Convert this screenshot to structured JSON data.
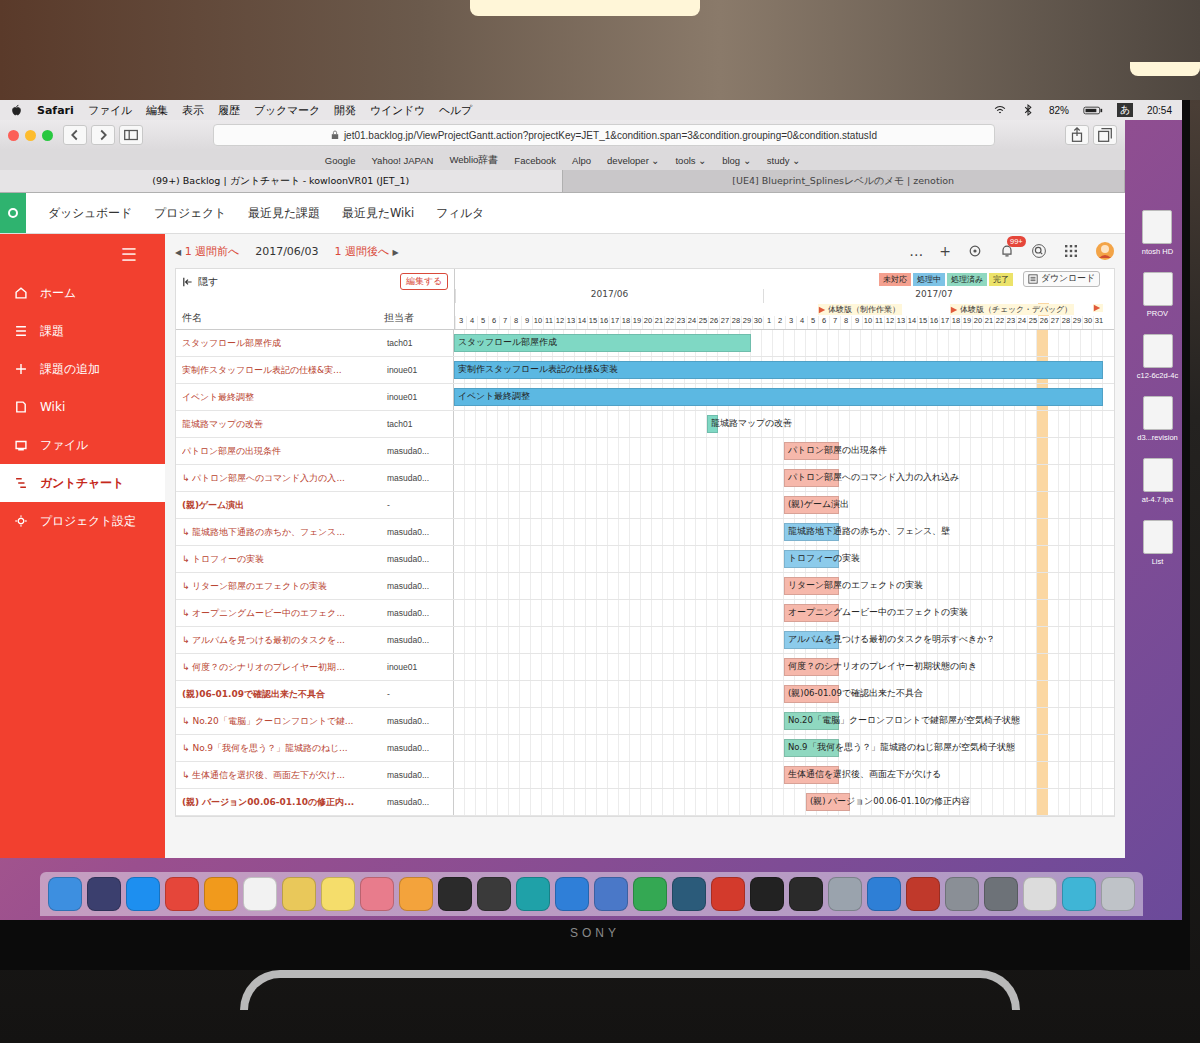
{
  "menubar": {
    "app": "Safari",
    "items": [
      "ファイル",
      "編集",
      "表示",
      "履歴",
      "ブックマーク",
      "開発",
      "ウインドウ",
      "ヘルプ"
    ],
    "status": {
      "battery": "82%",
      "input": "あ",
      "time": "20:54"
    }
  },
  "browser": {
    "url": "jet01.backlog.jp/ViewProjectGantt.action?projectKey=JET_1&condition.span=3&condition.grouping=0&condition.statusId",
    "bookmarks": [
      "Google",
      "Yahoo! JAPAN",
      "Weblio辞書",
      "Facebook",
      "Alpo",
      "developer ⌄",
      "tools ⌄",
      "blog ⌄",
      "study ⌄"
    ],
    "tabs": [
      {
        "label": "(99+) Backlog | ガントチャート - kowloonVR01 (JET_1)",
        "selected": true
      },
      {
        "label": "[UE4] Blueprint_Splinesレベルのメモ | zenotion",
        "selected": false
      }
    ]
  },
  "header": {
    "nav": [
      "ダッシュボード",
      "プロジェクト",
      "最近見た課題",
      "最近見たWiki",
      "フィルタ"
    ],
    "actions": [
      "…",
      "+"
    ],
    "badge": "99+"
  },
  "sidebar": {
    "menu": "☰",
    "items": [
      {
        "label": "ホーム",
        "selected": false
      },
      {
        "label": "課題",
        "selected": false
      },
      {
        "label": "課題の追加",
        "selected": false
      },
      {
        "label": "Wiki",
        "selected": false
      },
      {
        "label": "ファイル",
        "selected": false
      },
      {
        "label": "ガントチャート",
        "selected": true
      },
      {
        "label": "プロジェクト設定",
        "selected": false
      }
    ]
  },
  "toolbar": {
    "prev_arrow": "◀",
    "prev": "1 週間前へ",
    "date": "2017/06/03",
    "next": "1 週間後へ",
    "next_arrow": "▶",
    "hide": "隠す",
    "edit": "編集する",
    "download": "ダウンロード",
    "legend": [
      {
        "label": "未対応",
        "color": "#f4a08f"
      },
      {
        "label": "処理中",
        "color": "#7ec3e6"
      },
      {
        "label": "処理済み",
        "color": "#8fd8c0"
      },
      {
        "label": "完了",
        "color": "#ece36a"
      }
    ]
  },
  "gantt": {
    "columns": [
      "件名",
      "担当者"
    ],
    "months": [
      {
        "label": "2017/06",
        "days": [
          "3",
          "4",
          "5",
          "6",
          "7",
          "8",
          "9",
          "10",
          "11",
          "12",
          "13",
          "14",
          "15",
          "16",
          "17",
          "18",
          "19",
          "20",
          "21",
          "22",
          "23",
          "24",
          "25",
          "26",
          "27",
          "28",
          "29",
          "30"
        ]
      },
      {
        "label": "2017/07",
        "days": [
          "1",
          "2",
          "3",
          "4",
          "5",
          "6",
          "7",
          "8",
          "9",
          "10",
          "11",
          "12",
          "13",
          "14",
          "15",
          "16",
          "17",
          "18",
          "19",
          "20",
          "21",
          "22",
          "23",
          "24",
          "25",
          "26",
          "27",
          "28",
          "29",
          "30",
          "31"
        ]
      }
    ],
    "milestones": [
      {
        "label": "体験版（制作作業）",
        "day": 33
      },
      {
        "label": "体験版（チェック・デバッグ）",
        "day": 45
      },
      {
        "label": "",
        "day": 58
      }
    ],
    "today": 53,
    "tasks": [
      {
        "name": "スタッフロール部屋作成",
        "assignee": "tach01",
        "parent": false,
        "bar": {
          "label": "スタッフロール部屋作成",
          "start": 0,
          "days": 27,
          "color": "#7fd8c4"
        }
      },
      {
        "name": "実制作スタッフロール表記の仕様&実...",
        "assignee": "inoue01",
        "parent": false,
        "bar": {
          "label": "実制作スタッフロール表記の仕様&実装",
          "start": 0,
          "days": 59,
          "color": "#5cb8e2"
        }
      },
      {
        "name": "イベント最終調整",
        "assignee": "inoue01",
        "parent": false,
        "bar": {
          "label": "イベント最終調整",
          "start": 0,
          "days": 59,
          "color": "#5cb8e2"
        }
      },
      {
        "name": "龍城路マップの改善",
        "assignee": "tach01",
        "parent": false,
        "bar": {
          "label": "龍城路マップの改善",
          "start": 23,
          "days": 1,
          "color": "#7fd8c4"
        }
      },
      {
        "name": "パトロン部屋の出現条件",
        "assignee": "masuda0...",
        "parent": false,
        "bar": {
          "label": "パトロン部屋の出現条件",
          "start": 30,
          "days": 5,
          "color": "#f6b8ab"
        }
      },
      {
        "name": "↳ パトロン部屋へのコマンド入力の入...",
        "assignee": "masuda0...",
        "parent": false,
        "bar": {
          "label": "パトロン部屋へのコマンド入力の入れ込み",
          "start": 30,
          "days": 5,
          "color": "#f6b8ab"
        }
      },
      {
        "name": "(親)ゲーム演出",
        "assignee": "-",
        "parent": true,
        "bar": {
          "label": "(親)ゲーム演出",
          "start": 30,
          "days": 5,
          "color": "#f6b8ab"
        }
      },
      {
        "name": "↳ 龍城路地下通路の赤ちか、フェンス...",
        "assignee": "masuda0...",
        "parent": false,
        "bar": {
          "label": "龍城路地下通路の赤ちか、フェンス、壁",
          "start": 30,
          "days": 5,
          "color": "#8ccbeb"
        }
      },
      {
        "name": "↳ トロフィーの実装",
        "assignee": "masuda0...",
        "parent": false,
        "bar": {
          "label": "トロフィーの実装",
          "start": 30,
          "days": 5,
          "color": "#8ccbeb"
        }
      },
      {
        "name": "↳ リターン部屋のエフェクトの実装",
        "assignee": "masuda0...",
        "parent": false,
        "bar": {
          "label": "リターン部屋のエフェクトの実装",
          "start": 30,
          "days": 5,
          "color": "#f6b8ab"
        }
      },
      {
        "name": "↳ オープニングムービー中のエフェク...",
        "assignee": "masuda0...",
        "parent": false,
        "bar": {
          "label": "オープニングムービー中のエフェクトの実装",
          "start": 30,
          "days": 5,
          "color": "#f6b8ab"
        }
      },
      {
        "name": "↳ アルバムを見つける最初のタスクを...",
        "assignee": "masuda0...",
        "parent": false,
        "bar": {
          "label": "アルバムを見つける最初のタスクを明示すべきか？",
          "start": 30,
          "days": 5,
          "color": "#8ccbeb"
        }
      },
      {
        "name": "↳ 何度？のシナリオのプレイヤー初期...",
        "assignee": "inoue01",
        "parent": false,
        "bar": {
          "label": "何度？のシナリオのプレイヤー初期状態の向き",
          "start": 30,
          "days": 5,
          "color": "#f6b8ab"
        }
      },
      {
        "name": "(親)06-01.09で確認出来た不具合",
        "assignee": "-",
        "parent": true,
        "bar": {
          "label": "(親)06-01.09で確認出来た不具合",
          "start": 30,
          "days": 5,
          "color": "#f6b8ab"
        }
      },
      {
        "name": "↳ No.20「電脳」クーロンフロントで鍵...",
        "assignee": "masuda0...",
        "parent": false,
        "bar": {
          "label": "No.20「電脳」クーロンフロントで鍵部屋が空気椅子状態",
          "start": 30,
          "days": 5,
          "color": "#8fd8c0"
        }
      },
      {
        "name": "↳ No.9「我何を思う？」龍城路のねじ...",
        "assignee": "masuda0...",
        "parent": false,
        "bar": {
          "label": "No.9「我何を思う？」龍城路のねじ部屋が空気椅子状態",
          "start": 30,
          "days": 5,
          "color": "#8fd8c0"
        }
      },
      {
        "name": "↳ 生体通信を選択後、画面左下が欠け...",
        "assignee": "masuda0...",
        "parent": false,
        "bar": {
          "label": "生体通信を選択後、画面左下が欠ける",
          "start": 30,
          "days": 5,
          "color": "#f6b8ab"
        }
      },
      {
        "name": "(親) バージョン00.06-01.10の修正内...",
        "assignee": "masuda0...",
        "parent": true,
        "bar": {
          "label": "(親) バージョン00.06-01.10の修正内容",
          "start": 32,
          "days": 4,
          "color": "#f6b8ab"
        }
      }
    ]
  },
  "desktop": {
    "items": [
      "ntosh HD",
      "PROV",
      "c12-6c2d-4c",
      "d3...revision",
      "at-4.7.ipa",
      "List"
    ]
  },
  "dock": {
    "apps": [
      {
        "color": "#3d8fe0"
      },
      {
        "color": "#3b3f6e"
      },
      {
        "color": "#1d8ff0"
      },
      {
        "color": "#e5463a"
      },
      {
        "color": "#f19a1c"
      },
      {
        "color": "#f2f2f2"
      },
      {
        "color": "#e9c85a"
      },
      {
        "color": "#f5dd6b"
      },
      {
        "color": "#e87c8c"
      },
      {
        "color": "#f3a33c"
      },
      {
        "color": "#2b2b2b"
      },
      {
        "color": "#3a3a3a"
      },
      {
        "color": "#1fa1a8"
      },
      {
        "color": "#2f7fd8"
      },
      {
        "color": "#4a78c8"
      },
      {
        "color": "#34a853"
      },
      {
        "color": "#2b5b7a"
      },
      {
        "color": "#d33a2c"
      },
      {
        "color": "#222222"
      },
      {
        "color": "#2a2a2a"
      },
      {
        "color": "#9aa3ad"
      },
      {
        "color": "#2e7fd6"
      },
      {
        "color": "#c0392b"
      },
      {
        "color": "#8a8f96"
      },
      {
        "color": "#6d7278"
      },
      {
        "color": "#dcdcdc"
      },
      {
        "color": "#3fb5d6"
      },
      {
        "color": "#bfc3c8"
      }
    ]
  },
  "monitor": {
    "brand": "SONY"
  }
}
